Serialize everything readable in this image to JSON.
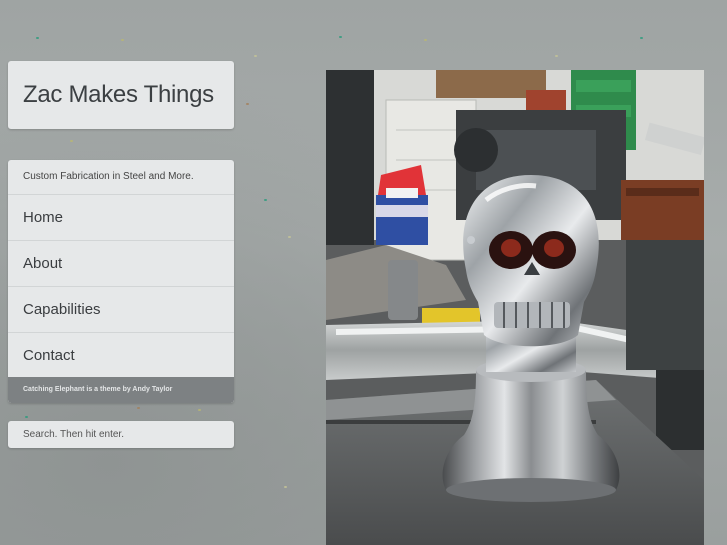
{
  "site": {
    "title": "Zac Makes Things",
    "tagline": "Custom Fabrication in Steel and More."
  },
  "nav": {
    "items": [
      {
        "label": "Home"
      },
      {
        "label": "About"
      },
      {
        "label": "Capabilities"
      },
      {
        "label": "Contact"
      }
    ]
  },
  "footer": {
    "credit": "Catching Elephant is a theme by Andy Taylor"
  },
  "search": {
    "placeholder": "Search. Then hit enter."
  },
  "colors": {
    "background": "#a3a8a7",
    "panel": "#e6e8e9",
    "credit_bar": "#7d8183",
    "text": "#3a3d40"
  },
  "icons": {
    "photo": "chrome-skull-shift-knob-photo"
  }
}
